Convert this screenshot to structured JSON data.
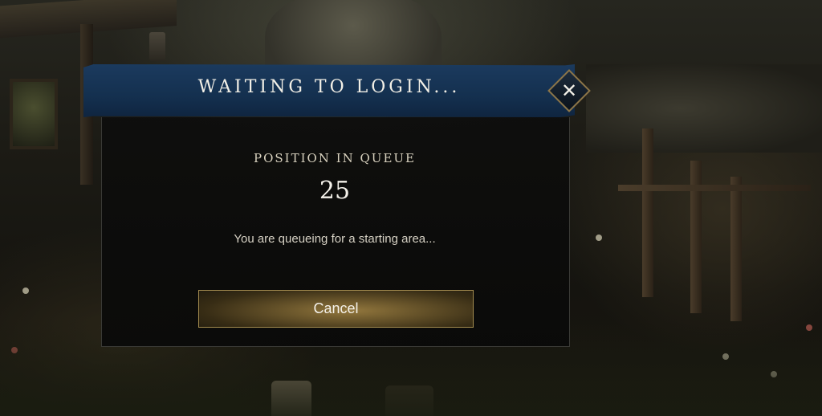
{
  "dialog": {
    "title": "WAITING TO LOGIN...",
    "close_icon": "close-icon",
    "queue_label": "POSITION IN QUEUE",
    "queue_position": "25",
    "status_message": "You are queueing for a starting area...",
    "cancel_label": "Cancel"
  },
  "colors": {
    "header": "#14304f",
    "panel": "#0e0e0d",
    "button_gold": "#a38b4f",
    "text": "#f2efe6"
  }
}
